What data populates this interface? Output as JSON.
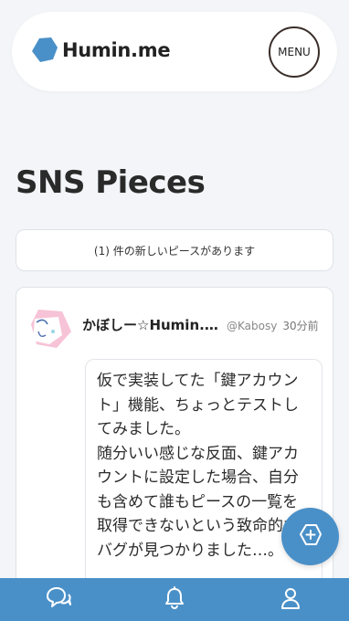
{
  "header": {
    "logo_text": "Humin.me",
    "menu_label": "MENU"
  },
  "page": {
    "title": "SNS Pieces"
  },
  "notice": {
    "text": "(1) 件の新しいピースがあります"
  },
  "pieces": [
    {
      "author_name": "かぼしー☆Humin.me",
      "author_handle": "@Kabosy",
      "time": "30分前",
      "body": "仮で実装してた「鍵アカウント」機能、ちょっとテストしてみました。\n随分いい感じな反面、鍵アカウントに設定した場合、自分も含めて誰もピースの一覧を取得できないという致命的なバグが見つかりました…。"
    }
  ],
  "icons": {
    "logo": "blue-hexagon-logo-icon",
    "fab": "add-piece-icon",
    "nav": [
      "chat-bubbles-icon",
      "bell-icon",
      "user-icon"
    ]
  },
  "colors": {
    "accent": "#4a90c8",
    "background": "#f3f5f8",
    "card": "#ffffff"
  }
}
